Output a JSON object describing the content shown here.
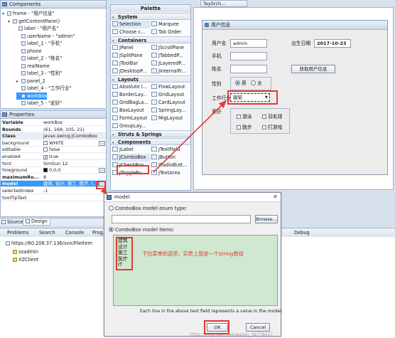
{
  "components_panel": {
    "title": "Components",
    "tree": [
      "frame - \"用户信息\"",
      "getContentPane()",
      "label - \"用户名\"",
      "userName - \"admin\"",
      "label_1 - \"手机\"",
      "phone",
      "label_2 - \"姓名\"",
      "realName",
      "label_3 - \"性别\"",
      "panel_2",
      "label_4 - \"工作行业\"",
      "workBox",
      "label_5 - \"爱好\""
    ]
  },
  "properties_panel": {
    "title": "Properties",
    "rows": [
      {
        "key": "Variable",
        "value": "workBox"
      },
      {
        "key": "Bounds",
        "value": "(61, 168, 105, 21)"
      },
      {
        "key": "Class",
        "value": "javax.swing.JComboBox"
      },
      {
        "key": "background",
        "value": "WHITE"
      },
      {
        "key": "editable",
        "value": "false"
      },
      {
        "key": "enabled",
        "value": "true"
      },
      {
        "key": "font",
        "value": "SimSun 12"
      },
      {
        "key": "foreground",
        "value": "0,0,0"
      },
      {
        "key": "maximumRo...",
        "value": "8"
      },
      {
        "key": "model",
        "value": "建筑, 设计, 施工, 医疗, I..."
      },
      {
        "key": "selectedIndex",
        "value": "-1"
      },
      {
        "key": "toolTipText",
        "value": ""
      }
    ],
    "button_label": "..."
  },
  "palette": {
    "title": "Palette",
    "sections": {
      "system": "System",
      "containers": "Containers",
      "layouts": "Layouts",
      "struts": "Struts & Springs",
      "components": "Components"
    },
    "system_items": [
      "Selection",
      "Marquee",
      "Choose c...",
      "Tab Order"
    ],
    "containers_items": [
      "JPanel",
      "JScrollPane",
      "JSplitPane",
      "JTabbedP...",
      "JToolBar",
      "JLayeredP...",
      "JDesktopP...",
      "JInternalFr..."
    ],
    "layouts_items": [
      "Absolute l...",
      "FlowLayout",
      "BorderLay...",
      "GridLayout",
      "GridBagLa...",
      "CardLayout",
      "BoxLayout",
      "SpringLay...",
      "FormLayout",
      "MigLayout",
      "GroupLay..."
    ],
    "components_items": [
      "JLabel",
      "JTextField",
      "JComboBox",
      "JButton",
      "JCheckBox",
      "JRadioButt...",
      "JToggleBu...",
      "JTextArea"
    ]
  },
  "form": {
    "window_title": "用户信息",
    "username_label": "用户名",
    "username_value": "admin",
    "birth_label": "出生日期",
    "birth_value": "2017-10-23",
    "phone_label": "手机",
    "name_label": "姓名",
    "get_info_button": "获取用户信息",
    "gender_label": "性别",
    "gender_male": "男",
    "gender_female": "女",
    "work_label": "工作行业",
    "work_value": "建筑",
    "hobby_label": "爱好",
    "hobbies": [
      "游泳",
      "羽毛球",
      "跑步",
      "打游戏"
    ]
  },
  "top_tab": "TaySrch...",
  "bottom_left_tabs": [
    "Source",
    "Design"
  ],
  "bottom_tabs": [
    "Problems",
    "Search",
    "Console",
    "Prog..."
  ],
  "bottom_tab_right": "Debug",
  "bottom_tree": [
    "https://60.208.37.136/svn/FileItem",
    "xzadmin",
    "XZClient"
  ],
  "dialog": {
    "title": "model",
    "enum_radio": "ComboBox model enum type:",
    "browse_button": "Browse...",
    "items_radio": "ComboBox model items:",
    "items": [
      "建筑",
      "设计",
      "施工",
      "医疗",
      "IT"
    ],
    "annotation": "下拉菜单的选项，实质上就是一个string数组",
    "footer_note": "Each line in the above text field represents a value in the model.",
    "ok_button": "OK",
    "cancel_button": "Cancel",
    "watermark": "https://blog.csdn.net/weixin_39778417"
  },
  "colors": {
    "selection": "#3399ff",
    "annotation_red": "#e53935",
    "items_bg": "#cfe8cf"
  }
}
